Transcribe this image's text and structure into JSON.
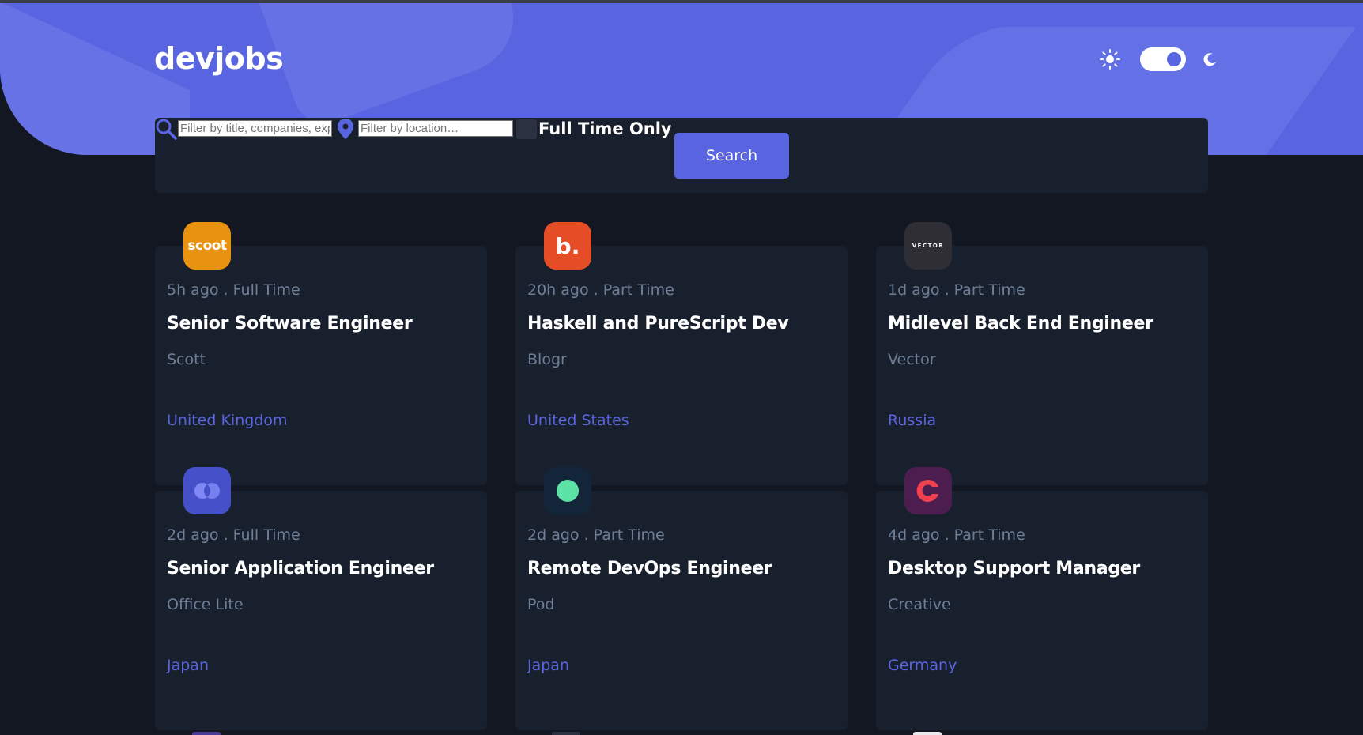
{
  "app": {
    "logo": "devjobs"
  },
  "theme": {
    "light_icon": "sun-icon",
    "dark_icon": "moon-icon",
    "mode": "dark"
  },
  "search": {
    "title_placeholder": "Filter by title, companies, expertise…",
    "location_placeholder": "Filter by location…",
    "fulltime_label": "Full Time Only",
    "button_label": "Search"
  },
  "colors": {
    "accent": "#5964e0",
    "background": "#121721",
    "card": "#19202d",
    "muted": "#6e8098"
  },
  "jobs": [
    {
      "logo_text": "scoot",
      "logo_color": "#e99210",
      "posted": "5h ago",
      "sep": ".",
      "contract": "Full Time",
      "position": "Senior Software Engineer",
      "company": "Scott",
      "location": "United Kingdom"
    },
    {
      "logo_text": "b.",
      "logo_color": "#e54d26",
      "posted": "20h ago",
      "sep": ".",
      "contract": "Part Time",
      "position": "Haskell and PureScript Dev",
      "company": "Blogr",
      "location": "United States"
    },
    {
      "logo_text": "VECTOR",
      "logo_color": "#2e2e34",
      "posted": "1d ago",
      "sep": ".",
      "contract": "Part Time",
      "position": "Midlevel Back End Engineer",
      "company": "Vector",
      "location": "Russia"
    },
    {
      "logo_text": "",
      "logo_color": "#4650c8",
      "posted": "2d ago",
      "sep": ".",
      "contract": "Full Time",
      "position": "Senior Application Engineer",
      "company": "Office Lite",
      "location": "Japan"
    },
    {
      "logo_text": "",
      "logo_color": "#132538",
      "posted": "2d ago",
      "sep": ".",
      "contract": "Part Time",
      "position": "Remote DevOps Engineer",
      "company": "Pod",
      "location": "Japan"
    },
    {
      "logo_text": "",
      "logo_color": "#4b1e4f",
      "posted": "4d ago",
      "sep": ".",
      "contract": "Part Time",
      "position": "Desktop Support Manager",
      "company": "Creative",
      "location": "Germany"
    }
  ]
}
